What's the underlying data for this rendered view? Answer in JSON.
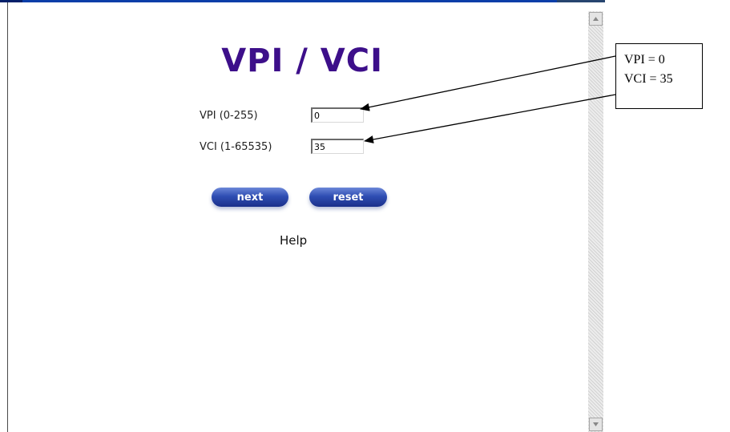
{
  "page": {
    "title": "VPI / VCI",
    "help_link": "Help"
  },
  "form": {
    "vpi": {
      "label": "VPI (0-255)",
      "value": "0"
    },
    "vci": {
      "label": "VCI (1-65535)",
      "value": "35"
    }
  },
  "buttons": {
    "next_label": "next",
    "reset_label": "reset"
  },
  "annotation": {
    "line1": "VPI = 0",
    "line2": "VCI = 35"
  },
  "colors": {
    "title": "#3d0f8a",
    "button": "#2f4eb3"
  }
}
